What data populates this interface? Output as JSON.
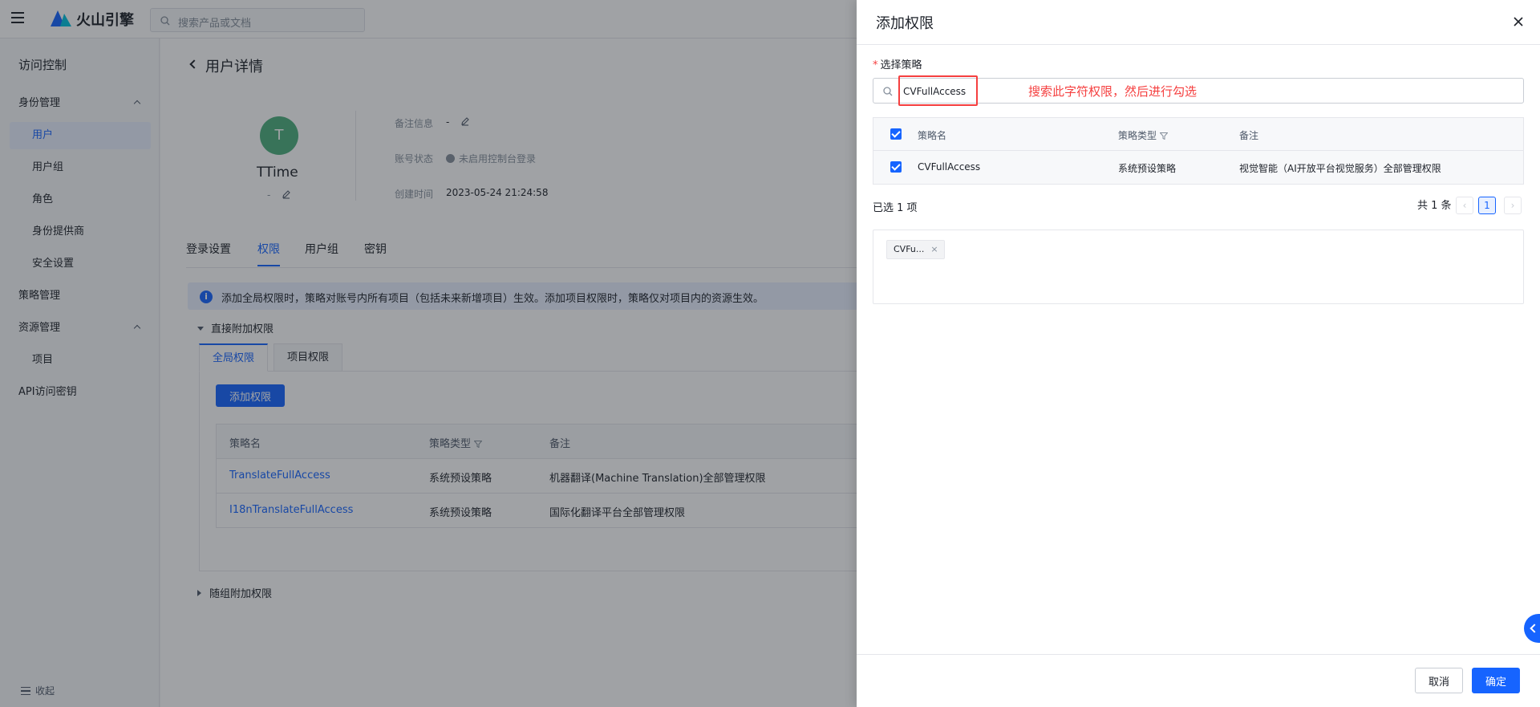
{
  "topbar": {
    "logo_text": "火山引擎",
    "search_placeholder": "搜索产品或文档"
  },
  "sidebar": {
    "title": "访问控制",
    "items": [
      {
        "label": "身份管理"
      },
      {
        "label": "用户"
      },
      {
        "label": "用户组"
      },
      {
        "label": "角色"
      },
      {
        "label": "身份提供商"
      },
      {
        "label": "安全设置"
      },
      {
        "label": "策略管理"
      },
      {
        "label": "资源管理"
      },
      {
        "label": "项目"
      },
      {
        "label": "API访问密钥"
      }
    ],
    "collapse_label": "收起"
  },
  "page": {
    "title": "用户详情",
    "user": {
      "avatar_letter": "T",
      "name": "TTime",
      "remark": "-"
    },
    "info": {
      "remark_label": "备注信息",
      "remark_value": "-",
      "status_label": "账号状态",
      "status_value": "未启用控制台登录",
      "created_label": "创建时间",
      "created_value": "2023-05-24 21:24:58"
    },
    "tabs": [
      "登录设置",
      "权限",
      "用户组",
      "密钥"
    ],
    "notice": "添加全局权限时，策略对账号内所有项目（包括未来新增项目）生效。添加项目权限时，策略仅对项目内的资源生效。",
    "section_direct": "直接附加权限",
    "sub_tabs": [
      "全局权限",
      "项目权限"
    ],
    "add_button": "添加权限",
    "table": {
      "columns": [
        "策略名",
        "策略类型",
        "备注"
      ],
      "rows": [
        {
          "name": "TranslateFullAccess",
          "type": "系统预设策略",
          "remark": "机器翻译(Machine Translation)全部管理权限"
        },
        {
          "name": "I18nTranslateFullAccess",
          "type": "系统预设策略",
          "remark": "国际化翻译平台全部管理权限"
        }
      ]
    },
    "section_group": "随组附加权限"
  },
  "drawer": {
    "title": "添加权限",
    "field_label": "选择策略",
    "search_value": "CVFullAccess",
    "annotation": "搜索此字符权限，然后进行勾选",
    "table": {
      "columns": [
        "策略名",
        "策略类型",
        "备注"
      ],
      "rows": [
        {
          "name": "CVFullAccess",
          "type": "系统预设策略",
          "remark": "视觉智能（AI开放平台视觉服务）全部管理权限"
        }
      ]
    },
    "selected_count": "已选 1 项",
    "total": "共 1 条",
    "current_page": "1",
    "selected_tag": "CVFu...",
    "cancel": "取消",
    "confirm": "确定"
  },
  "colors": {
    "primary": "#1664ff",
    "annotation": "#f53f3f",
    "avatar": "#4caf7d"
  }
}
